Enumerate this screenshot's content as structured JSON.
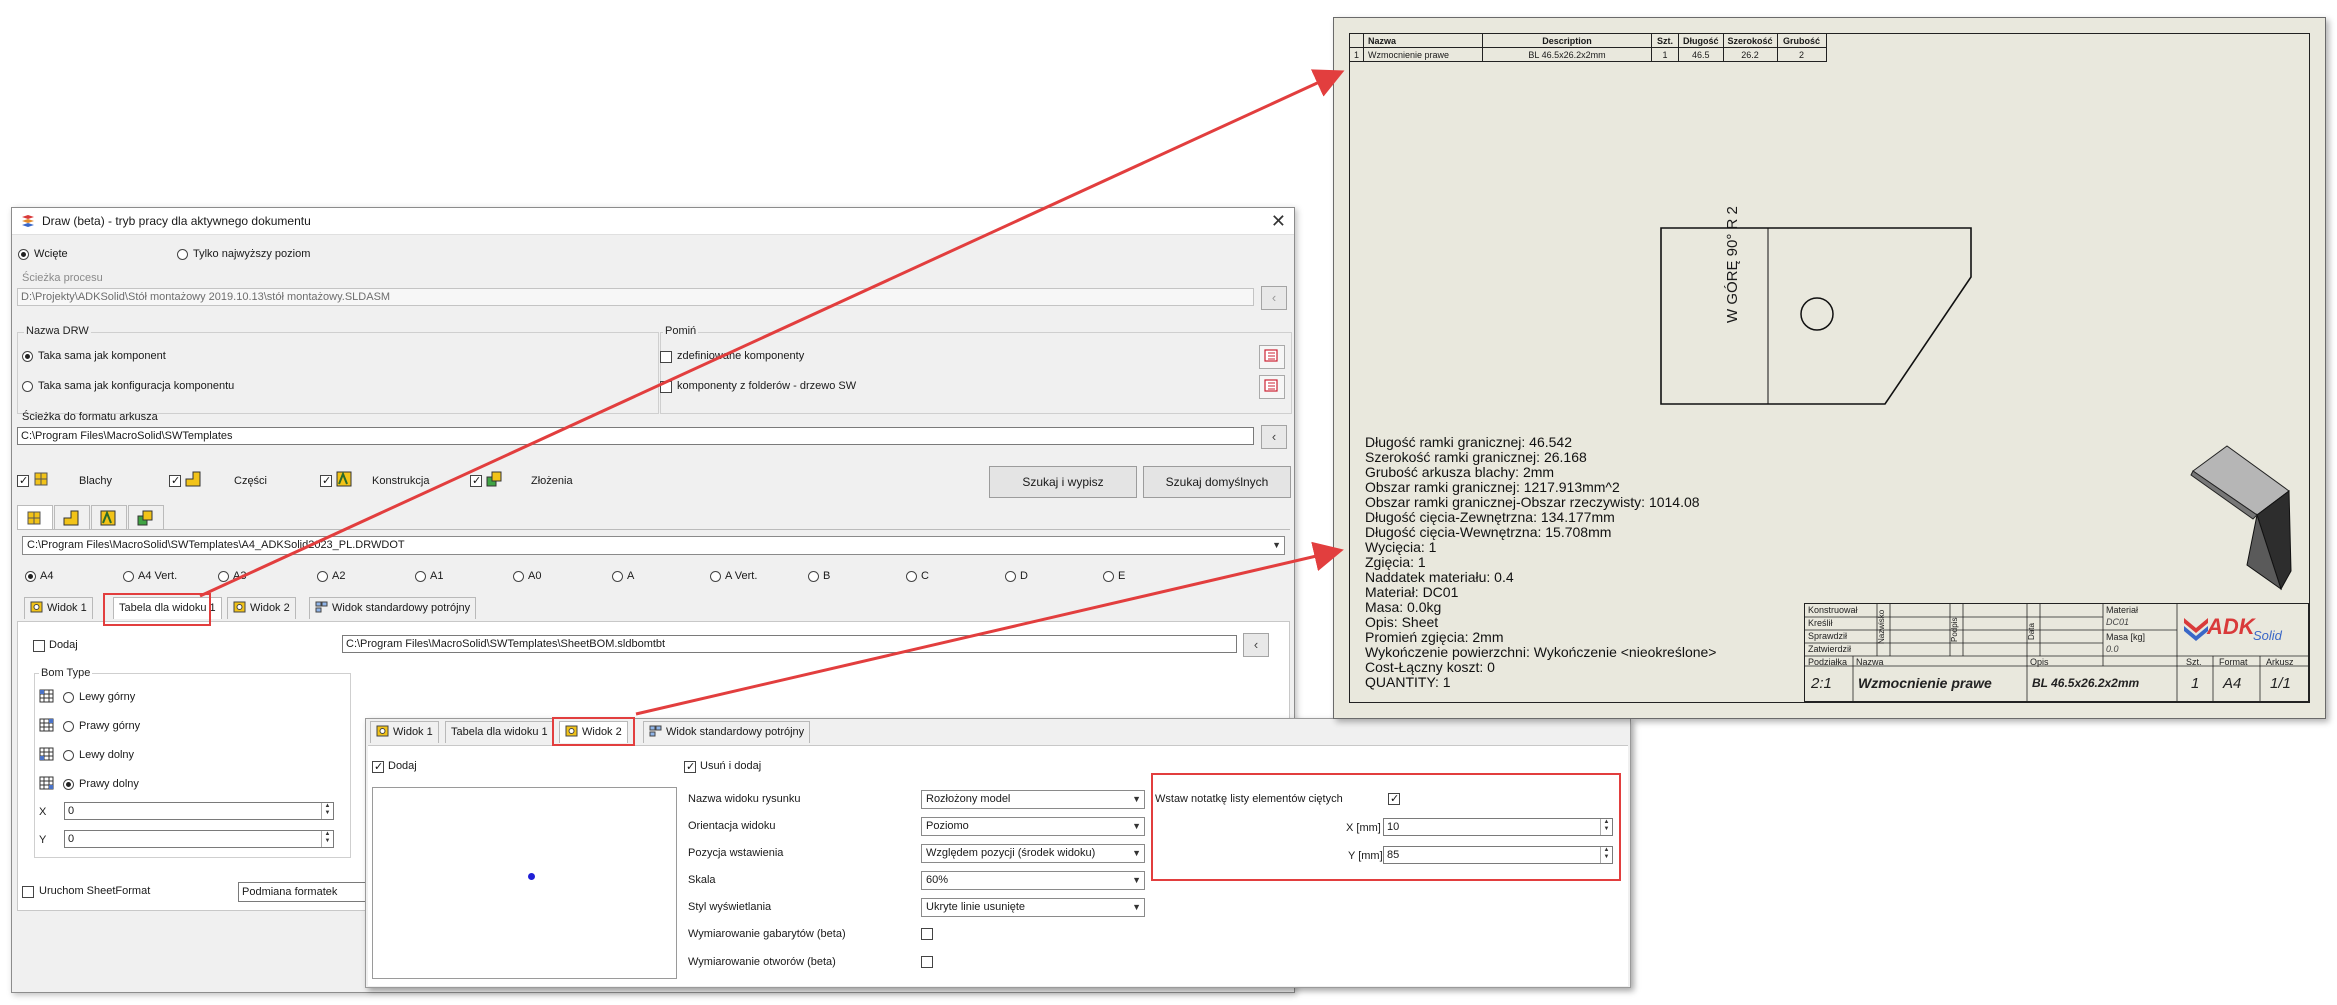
{
  "dialog": {
    "title": "Draw (beta) - tryb pracy dla aktywnego dokumentu",
    "mode_options": [
      "Wcięte",
      "Tylko najwyższy poziom"
    ],
    "process_path_label": "Ścieżka procesu",
    "process_path_value": "D:\\Projekty\\ADKSolid\\Stół montażowy 2019.10.13\\stół montażowy.SLDASM",
    "drw_name_group": "Nazwa DRW",
    "drw_name_options": [
      "Taka sama jak komponent",
      "Taka sama jak konfiguracja komponentu"
    ],
    "skip_group": "Pomiń",
    "skip_options": [
      "zdefiniowane komponenty",
      "komponenty z folderów - drzewo SW"
    ],
    "sheet_format_path_label": "Ścieżka do formatu arkusza",
    "sheet_format_path_value": "C:\\Program Files\\MacroSolid\\SWTemplates",
    "categories": [
      "Blachy",
      "Części",
      "Konstrukcja",
      "Złożenia"
    ],
    "search_button": "Szukaj i wypisz",
    "default_search_button": "Szukaj domyślnych",
    "template_value": "C:\\Program Files\\MacroSolid\\SWTemplates\\A4_ADKSolid2023_PL.DRWDOT",
    "formats": [
      "A4",
      "A4 Vert.",
      "A3",
      "A2",
      "A1",
      "A0",
      "A",
      "A Vert.",
      "B",
      "C",
      "D",
      "E"
    ],
    "tabs": [
      "Widok 1",
      "Tabela dla widoku 1",
      "Widok 2",
      "Widok standardowy potrójny"
    ],
    "add_label": "Dodaj",
    "bom_template_value": "C:\\Program Files\\MacroSolid\\SWTemplates\\SheetBOM.sldbomtbt",
    "bom_type_group": "Bom Type",
    "bom_types": [
      "Lewy górny",
      "Prawy górny",
      "Lewy dolny",
      "Prawy dolny"
    ],
    "x_label": "X",
    "x_value": "0",
    "y_label": "Y",
    "y_value": "0",
    "run_sheetformat_label": "Uruchom SheetFormat",
    "replace_format_value": "Podmiana formatek"
  },
  "view2_panel": {
    "tabs": [
      "Widok 1",
      "Tabela dla widoku 1",
      "Widok 2",
      "Widok standardowy potrójny"
    ],
    "add_label": "Dodaj",
    "remove_add_label": "Usuń i dodaj",
    "rows": [
      {
        "label": "Nazwa widoku rysunku",
        "value": "Rozłożony model"
      },
      {
        "label": "Orientacja widoku",
        "value": "Poziomo"
      },
      {
        "label": "Pozycja wstawienia",
        "value": "Względem pozycji (środek widoku)"
      },
      {
        "label": "Skala",
        "value": "60%"
      },
      {
        "label": "Styl wyświetlania",
        "value": "Ukryte linie usunięte"
      }
    ],
    "bbox_dims_label": "Wymiarowanie gabarytów (beta)",
    "hole_dims_label": "Wymiarowanie otworów (beta)",
    "insert_note_label": "Wstaw notatkę listy elementów ciętych",
    "x_mm_label": "X [mm]",
    "x_mm_value": "10",
    "y_mm_label": "Y [mm]",
    "y_mm_value": "85"
  },
  "drawing": {
    "bom_headers": [
      "Nazwa",
      "Description",
      "Szt.",
      "Długość",
      "Szerokość",
      "Grubość"
    ],
    "bom_row": [
      "1",
      "Wzmocnienie prawe",
      "BL 46.5x26.2x2mm",
      "1",
      "46.5",
      "26.2",
      "2"
    ],
    "bend_note": "W GÓRĘ  90°  R 2",
    "properties": [
      "Długość ramki granicznej: 46.542",
      "Szerokość ramki granicznej: 26.168",
      "Grubość arkusza blachy: 2mm",
      "Obszar ramki granicznej: 1217.913mm^2",
      "Obszar ramki granicznej-Obszar rzeczywisty: 1014.08",
      "Długość cięcia-Zewnętrzna: 134.177mm",
      "Długość cięcia-Wewnętrzna: 15.708mm",
      "Wycięcia: 1",
      "Zgięcia: 1",
      "Naddatek materiału: 0.4",
      "Materiał: DC01",
      "Masa: 0.0kg",
      "Opis: Sheet",
      "Promień zgięcia: 2mm",
      "Wykończenie powierzchni: Wykończenie <nieokreślone>",
      "Cost-Łączny koszt: 0",
      "QUANTITY: 1"
    ],
    "title_block": {
      "roles": [
        "Konstruował",
        "Kreślił",
        "Sprawdził",
        "Zatwierdził"
      ],
      "vertical_labels": [
        "Nazwisko",
        "Podpis",
        "Data"
      ],
      "material_label": "Materiał",
      "material_value": "DC01",
      "mass_label": "Masa [kg]",
      "mass_value": "0.0",
      "scale_label": "Podziałka",
      "scale_value": "2:1",
      "name_label": "Nazwa",
      "name_value": "Wzmocnienie prawe",
      "desc_label": "Opis",
      "desc_value": "BL 46.5x26.2x2mm",
      "qty_label": "Szt.",
      "qty_value": "1",
      "format_label": "Format",
      "format_value": "A4",
      "sheet_label": "Arkusz",
      "sheet_value": "1/1",
      "logo_text": "ADK",
      "logo_sub": "Solid"
    }
  },
  "colors": {
    "highlight": "#e23e3e",
    "window_bg": "#f0f0f0",
    "drawing_bg": "#e9e8dd"
  }
}
